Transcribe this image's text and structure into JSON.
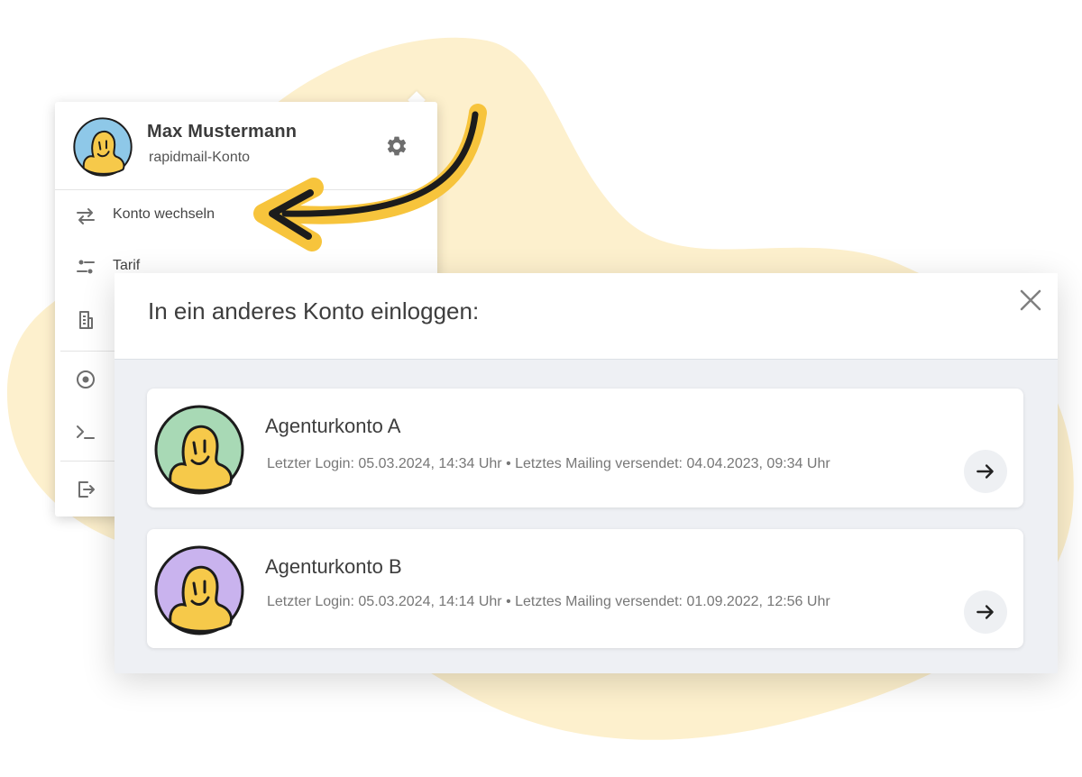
{
  "colors": {
    "blob": "#fdf0cd",
    "arrow_yellow": "#f7c43c",
    "arrow_dark": "#1c1c1c",
    "icon_gray": "#6e6e6e"
  },
  "menu": {
    "user_name": "Max Mustermann",
    "account_label": "rapidmail-Konto",
    "settings_icon": "gear-icon",
    "items": [
      {
        "label": "Konto wechseln",
        "icon": "swap-arrows-icon"
      },
      {
        "label": "Tarif",
        "icon": "sliders-icon"
      }
    ]
  },
  "modal": {
    "title": "In ein anderes Konto einloggen:",
    "close_icon": "close-icon",
    "accounts": [
      {
        "name": "Agenturkonto A",
        "meta": "Letzter Login: 05.03.2024, 14:34 Uhr • Letztes Mailing versendet: 04.04.2023, 09:34 Uhr",
        "avatar_bg": "#a8d9b5"
      },
      {
        "name": "Agenturkonto B",
        "meta": "Letzter Login: 05.03.2024, 14:14 Uhr • Letztes Mailing versendet: 01.09.2022, 12:56 Uhr",
        "avatar_bg": "#c9b3ee"
      }
    ]
  }
}
